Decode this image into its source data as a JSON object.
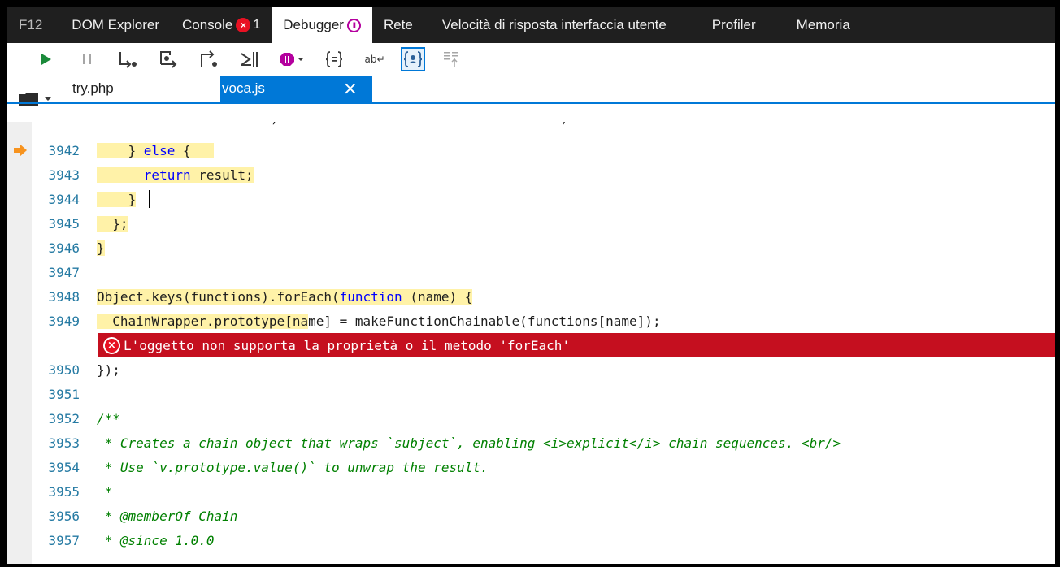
{
  "menubar": {
    "tabs": [
      {
        "label": "F12"
      },
      {
        "label": "DOM Explorer"
      },
      {
        "label": "Console"
      },
      {
        "label": "Debugger"
      },
      {
        "label": "Rete"
      },
      {
        "label": "Velocità di risposta interfaccia utente"
      },
      {
        "label": "Profiler"
      },
      {
        "label": "Memoria"
      }
    ],
    "console_error_icon": "×",
    "console_error_count": "1",
    "debugger_pause_icon": "II"
  },
  "toolbar": {
    "icons": [
      "play-icon",
      "pause-icon",
      "step-over-icon",
      "step-into-icon",
      "step-out-icon",
      "break-new-worker-icon",
      "break-on-exceptions-icon",
      "pretty-print-icon",
      "word-wrap-icon",
      "just-my-code-icon",
      "source-map-icon"
    ],
    "word_wrap_glyph": "ab↵"
  },
  "filetabs": {
    "folder_icon": "folder-icon",
    "files": [
      {
        "label": "try.php",
        "active": false
      },
      {
        "label": "voca.js",
        "active": true
      }
    ],
    "close_glyph": "×"
  },
  "code": {
    "current_line": "3942",
    "lines": [
      {
        "n": "3942",
        "text": "    } else {"
      },
      {
        "n": "3943",
        "text": "      return result;"
      },
      {
        "n": "3944",
        "text": "    }"
      },
      {
        "n": "3945",
        "text": "  };"
      },
      {
        "n": "3946",
        "text": "}"
      },
      {
        "n": "3947",
        "text": ""
      },
      {
        "n": "3948",
        "text": "Object.keys(functions).forEach(function (name) {"
      },
      {
        "n": "3949",
        "text": "  ChainWrapper.prototype[name] = makeFunctionChainable(functions[name]);"
      },
      {
        "n": "3950",
        "text": "});"
      },
      {
        "n": "3951",
        "text": ""
      },
      {
        "n": "3952",
        "text": "/**"
      },
      {
        "n": "3953",
        "text": " * Creates a chain object that wraps `subject`, enabling <i>explicit</i> chain sequences. <br/>"
      },
      {
        "n": "3954",
        "text": " * Use `v.prototype.value()` to unwrap the result."
      },
      {
        "n": "3955",
        "text": " *"
      },
      {
        "n": "3956",
        "text": " * @memberOf Chain"
      },
      {
        "n": "3957",
        "text": " * @since 1.0.0"
      }
    ],
    "error": {
      "icon": "×",
      "message": "L'oggetto non supporta la proprietà o il metodo 'forEach'"
    }
  },
  "colors": {
    "accent": "#0078d7",
    "error": "#c50f1f",
    "highlight": "#fff2a8",
    "keyword": "#0000ff",
    "comment": "#008000",
    "line_number": "#257aa3",
    "current_arrow": "#f7931e"
  }
}
